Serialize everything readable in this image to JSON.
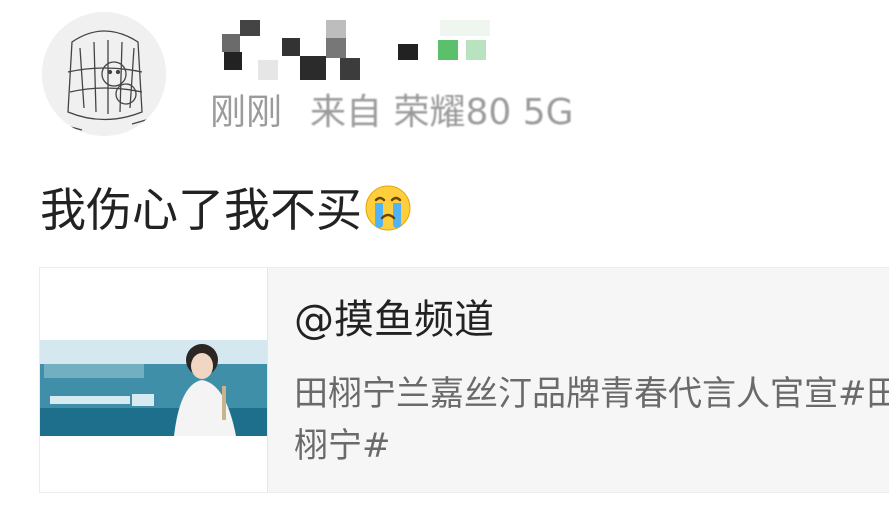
{
  "post": {
    "time": "刚刚",
    "source": "来自 荣耀80 5G",
    "text": "我伤心了我不买",
    "emoji_icon": "crying-face-icon"
  },
  "card": {
    "title": "@摸鱼频道",
    "description": "田栩宁兰嘉丝汀品牌青春代言人官宣#田栩宁#",
    "thumbnail": "lancaster-ad-banner-thumbnail"
  },
  "colors": {
    "meta_text": "#9b9b9b",
    "body_text": "#222222",
    "desc_text": "#6a6a6a",
    "card_bg": "#f6f6f6",
    "mosaic_green": "#5cbf6c"
  }
}
